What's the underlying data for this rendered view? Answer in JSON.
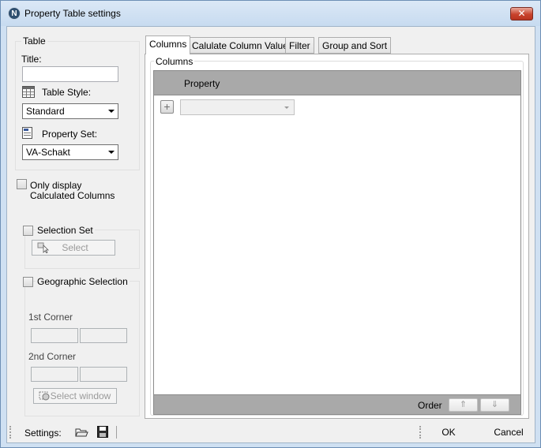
{
  "window": {
    "title": "Property Table settings",
    "app_icon_letter": "N",
    "close_glyph": "✕"
  },
  "table_group": {
    "title": "Table",
    "title_label": "Title:",
    "title_value": "",
    "table_style_label": "Table Style:",
    "table_style_value": "Standard",
    "property_set_label": "Property Set:",
    "property_set_value": "VA-Schakt"
  },
  "only_display_calculated": {
    "label_line1": "Only display",
    "label_line2": "Calculated Columns",
    "checked": false
  },
  "selection_set": {
    "label": "Selection Set",
    "checked": false,
    "select_button": "Select"
  },
  "geographic_selection": {
    "label": "Geographic Selection",
    "checked": false,
    "first_corner": "1st Corner",
    "second_corner": "2nd Corner",
    "select_window_button": "Select window"
  },
  "tabs": [
    {
      "label": "Columns",
      "active": true
    },
    {
      "label": "Calulate Column Values",
      "active": false
    },
    {
      "label": "Filter",
      "active": false
    },
    {
      "label": "Group and Sort",
      "active": false
    }
  ],
  "columns_panel": {
    "group_title": "Columns",
    "header_property": "Property",
    "add_glyph": "+",
    "property_value": "",
    "order_label": "Order",
    "up_glyph": "⇑",
    "down_glyph": "⇓"
  },
  "bottom": {
    "settings_label": "Settings:",
    "ok_label": "OK",
    "cancel_label": "Cancel"
  },
  "icons": {
    "app": "app-n-icon",
    "table_style": "table-grid-icon",
    "property_set": "property-set-icon",
    "select": "select-cursor-icon",
    "select_window": "select-window-icon",
    "open": "folder-open-icon",
    "save": "floppy-save-icon"
  },
  "colors": {
    "title_bar": "#cfe0f2",
    "close_button": "#c8432c",
    "grid_header": "#a9a9a9"
  }
}
